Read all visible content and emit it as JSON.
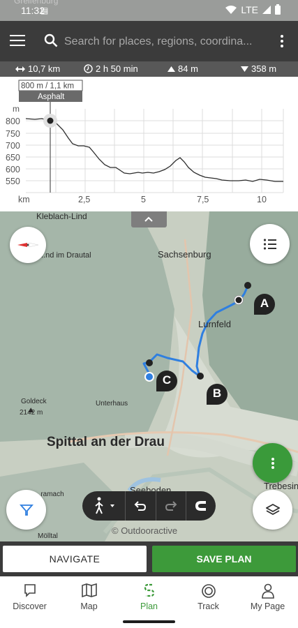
{
  "status_bar": {
    "time": "11:32",
    "network": "LTE",
    "ghost_place": "Greifenburg"
  },
  "search": {
    "placeholder": "Search for places, regions, coordina..."
  },
  "stats": {
    "distance": "10,7 km",
    "duration": "2 h 50 min",
    "ascent": "84 m",
    "descent": "358 m"
  },
  "profile": {
    "tooltip_position": "800 m / 1,1 km",
    "tooltip_surface": "Asphalt",
    "y_unit": "m",
    "x_unit": "km",
    "y_ticks": [
      "800",
      "750",
      "700",
      "650",
      "600",
      "550"
    ],
    "x_ticks": [
      "2,5",
      "5",
      "7,5",
      "10"
    ]
  },
  "map": {
    "labels": {
      "sachsenburg": "Sachsenburg",
      "lurnfeld": "Lurnfeld",
      "spittal": "Spittal an der Drau",
      "kleblach": "Kleblach-Lind",
      "drautal": "...nd im Drautal",
      "goldeck": "Goldeck",
      "goldeck_height": "2142 m",
      "unterhaus": "Unterhaus",
      "trebesing": "Trebesin...",
      "seeboden": "Seeboden",
      "amlach": "...ramach",
      "moelltal": "Mölltal"
    },
    "waypoints": [
      "A",
      "B",
      "C"
    ],
    "attribution": "© Outdooractive"
  },
  "actions": {
    "navigate": "NAVIGATE",
    "save_plan": "SAVE PLAN"
  },
  "bottom_nav": [
    {
      "label": "Discover",
      "icon": "discover-icon"
    },
    {
      "label": "Map",
      "icon": "map-icon"
    },
    {
      "label": "Plan",
      "icon": "plan-icon",
      "active": true
    },
    {
      "label": "Track",
      "icon": "track-icon"
    },
    {
      "label": "My Page",
      "icon": "user-icon"
    }
  ],
  "colors": {
    "accent_green": "#3d9a3a",
    "header_dark": "#3b3b3b",
    "route_blue": "#2f7fe0"
  }
}
